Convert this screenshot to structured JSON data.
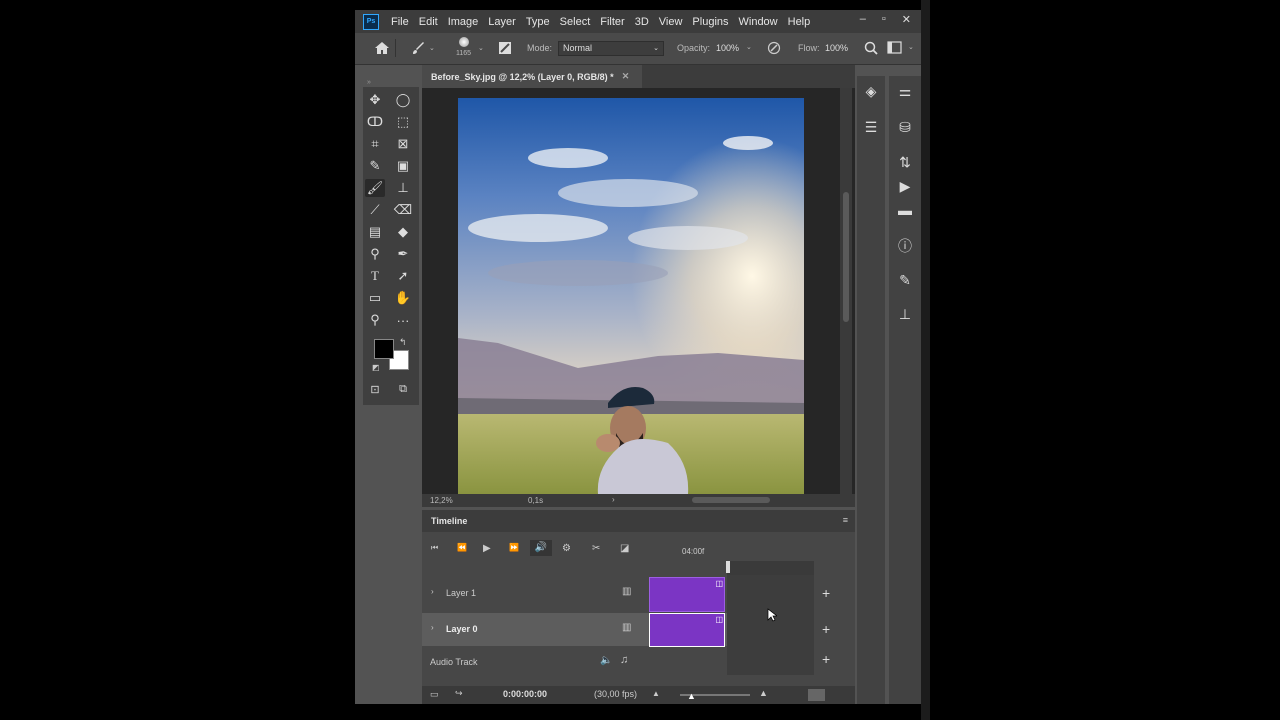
{
  "menu": {
    "logo_text": "Ps",
    "items": [
      "File",
      "Edit",
      "Image",
      "Layer",
      "Type",
      "Select",
      "Filter",
      "3D",
      "View",
      "Plugins",
      "Window",
      "Help"
    ],
    "window_controls": [
      "–",
      "▫",
      "✕"
    ]
  },
  "options": {
    "brush_size": "1165",
    "mode_label": "Mode:",
    "mode_value": "Normal",
    "opacity_label": "Opacity:",
    "opacity_value": "100%",
    "flow_label": "Flow:",
    "flow_value": "100%"
  },
  "document": {
    "tab_title": "Before_Sky.jpg @ 12,2% (Layer 0, RGB/8) *",
    "zoom": "12,2%",
    "status_value": "0,1s"
  },
  "timeline": {
    "title": "Timeline",
    "time_marker": "04:00f",
    "tracks": [
      {
        "name": "Layer 1"
      },
      {
        "name": "Layer 0"
      },
      {
        "name": "Audio Track"
      }
    ],
    "current_time": "0:00:00:00",
    "fps": "(30,00 fps)"
  },
  "colors": {
    "accent": "#31a8ff",
    "clip": "#7b35c4",
    "panel_bg": "#535353",
    "menu_bg": "#3c3c3c"
  }
}
